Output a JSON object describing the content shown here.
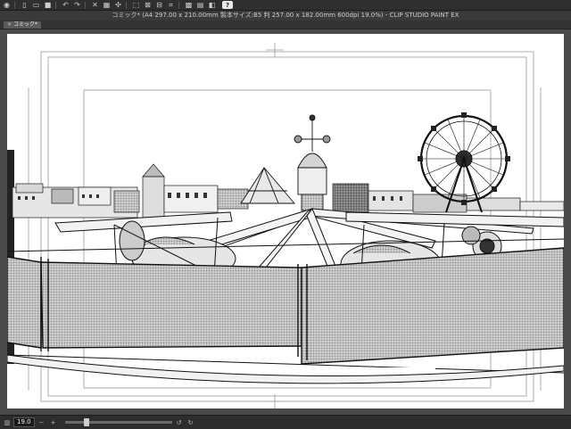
{
  "window": {
    "title": "コミック* (A4 297.00 x 210.00mm 製本サイズ:B5 判 257.00 x 182.00mm 600dpi 19.0%)  - CLIP STUDIO PAINT EX"
  },
  "toolbar": {
    "items": [
      "menu-icon",
      "new-icon",
      "open-icon",
      "save-icon",
      "undo-icon",
      "redo-icon",
      "clear-icon",
      "fill-icon",
      "transform-icon",
      "select-icon",
      "deselect-icon",
      "invert-selection-icon",
      "crop-icon",
      "grid-icon",
      "ruler-icon",
      "snap-icon"
    ],
    "help_label": "?"
  },
  "tabs": [
    {
      "label": "コミック*",
      "active": true
    }
  ],
  "status": {
    "zoom": "19.0",
    "zoom_slider_fraction": 0.19
  },
  "colors": {
    "toolbar_bg": "#2f2f2f",
    "canvas_bg": "#4a4a4a",
    "paper": "#ffffff",
    "ink": "#1a1a1a",
    "screentone": "#bdbdbd"
  }
}
